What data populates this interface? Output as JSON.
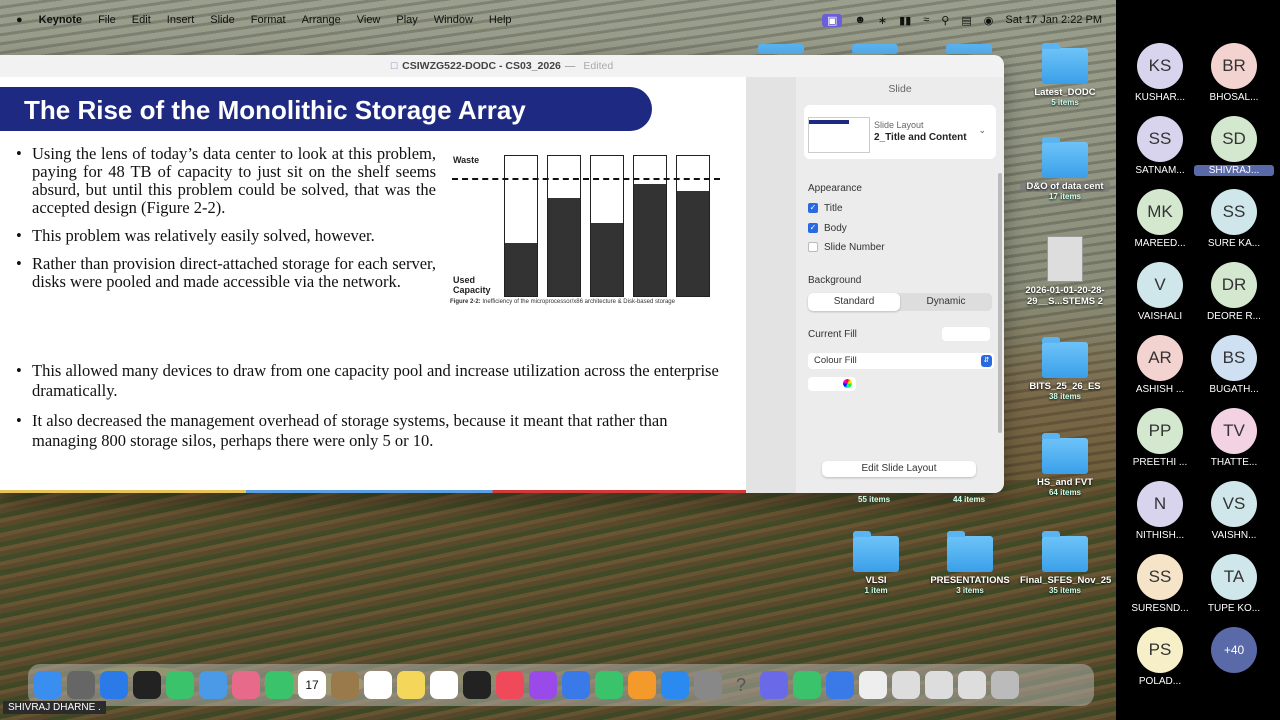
{
  "menubar": {
    "app": "Keynote",
    "items": [
      "File",
      "Edit",
      "Insert",
      "Slide",
      "Format",
      "Arrange",
      "View",
      "Play",
      "Window",
      "Help"
    ],
    "clock": "Sat 17 Jan  2:22 PM"
  },
  "window": {
    "title": "CSIWZG522-DODC - CS03_2026",
    "status": "Edited"
  },
  "slide": {
    "title": "The Rise of the Monolithic Storage Array",
    "bullets_narrow": [
      "Using the lens of today’s data center to look at this problem, paying for 48 TB of capacity to just sit on the shelf seems absurd, but until this problem could be solved, that was the accepted design (Figure 2-2).",
      "This problem was relatively easily solved, however.",
      "Rather than provision direct-attached storage for each server, disks were pooled and made accessible via the network."
    ],
    "bullets_wide": [
      "This allowed many devices to draw from one capacity pool and increase utilization across the enterprise dramatically.",
      "It also decreased the management overhead of storage systems, because it meant that rather than managing 800 storage silos, perhaps there were only 5 or 10."
    ],
    "figure": {
      "waste_label": "Waste",
      "used_label": "Used Capacity",
      "caption_bold": "Figure 2-2:",
      "caption": " Inefficiency of the microprocessor/x86 architecture & Disk-based storage",
      "used_fractions": [
        0.38,
        0.7,
        0.52,
        0.8,
        0.75
      ],
      "threshold_fraction": 0.85
    }
  },
  "inspector": {
    "header": "Slide",
    "layout_caption": "Slide Layout",
    "layout_name": "2_Title and Content",
    "appearance": "Appearance",
    "title_cb": "Title",
    "body_cb": "Body",
    "slide_number_cb": "Slide Number",
    "background": "Background",
    "standard": "Standard",
    "dynamic": "Dynamic",
    "current_fill": "Current Fill",
    "colour_fill": "Colour Fill",
    "edit_layout": "Edit Slide Layout"
  },
  "desktop_folders": [
    {
      "name": "Latest_DODC",
      "count": "5 items"
    },
    {
      "name": "D&O of data cent",
      "count": "17 items"
    },
    {
      "name": "2026-01-01-20-28-29__S...STEMS 2",
      "count": ""
    },
    {
      "name": "BITS_25_26_ES",
      "count": "38 items"
    },
    {
      "name": "HS_and FVT",
      "count": "64 items"
    },
    {
      "name": "VLSI",
      "count": "1 item"
    },
    {
      "name": "PRESENTATIONS",
      "count": "3 items"
    },
    {
      "name": "Final_SFES_Nov_25",
      "count": "35 items"
    }
  ],
  "partial_counts": [
    "55 items",
    "44 items"
  ],
  "participants": [
    {
      "initials": "KS",
      "name": "KUSHAR...",
      "color": "#d9d4ee"
    },
    {
      "initials": "BR",
      "name": "BHOSAL...",
      "color": "#f3d3cf"
    },
    {
      "initials": "SS",
      "name": "SATNAM...",
      "color": "#d9d4ee"
    },
    {
      "initials": "SD",
      "name": "SHIVRAJ...",
      "color": "#d4e8d0"
    },
    {
      "initials": "MK",
      "name": "MAREED...",
      "color": "#d4e8d0"
    },
    {
      "initials": "SS",
      "name": "SURE KA...",
      "color": "#cfe6ea"
    },
    {
      "initials": "V",
      "name": "VAISHALI",
      "color": "#cfe6ea"
    },
    {
      "initials": "DR",
      "name": "DEORE R...",
      "color": "#d4e8d0"
    },
    {
      "initials": "AR",
      "name": "ASHISH ...",
      "color": "#f3d3cf"
    },
    {
      "initials": "BS",
      "name": "BUGATH...",
      "color": "#cfe0f3"
    },
    {
      "initials": "PP",
      "name": "PREETHI ...",
      "color": "#d4e8d0"
    },
    {
      "initials": "TV",
      "name": "THATTE...",
      "color": "#f3d3e3"
    },
    {
      "initials": "N",
      "name": "NITHISH...",
      "color": "#d9d4ee"
    },
    {
      "initials": "VS",
      "name": "VAISHN...",
      "color": "#cfe6ea"
    },
    {
      "initials": "SS",
      "name": "SURESND...",
      "color": "#f6e4c8"
    },
    {
      "initials": "TA",
      "name": "TUPE KO...",
      "color": "#cfe6ea"
    },
    {
      "initials": "PS",
      "name": "POLAD...",
      "color": "#f6efc8"
    },
    {
      "initials": "+40",
      "name": "",
      "color": "#5a6aa8"
    }
  ],
  "speaker_name": "SHIVRAJ DHARNE .",
  "dock_icons": [
    "finder-icon",
    "launchpad-icon",
    "safari-icon",
    "opera-icon",
    "messages-icon",
    "maps-icon",
    "photos-icon",
    "facetime-icon",
    "calendar-icon",
    "system-icon",
    "reminders-icon",
    "notes-icon",
    "freeform-icon",
    "tv-icon",
    "music-icon",
    "podcasts-icon",
    "keynote-icon",
    "numbers-icon",
    "pages-icon",
    "appstore-icon",
    "settings-icon",
    "help-icon",
    "teams-icon",
    "whatsapp-icon",
    "mail-icon",
    "preview-icon",
    "window-icon",
    "window-icon",
    "window-icon",
    "trash-icon"
  ],
  "calendar_day": "17"
}
